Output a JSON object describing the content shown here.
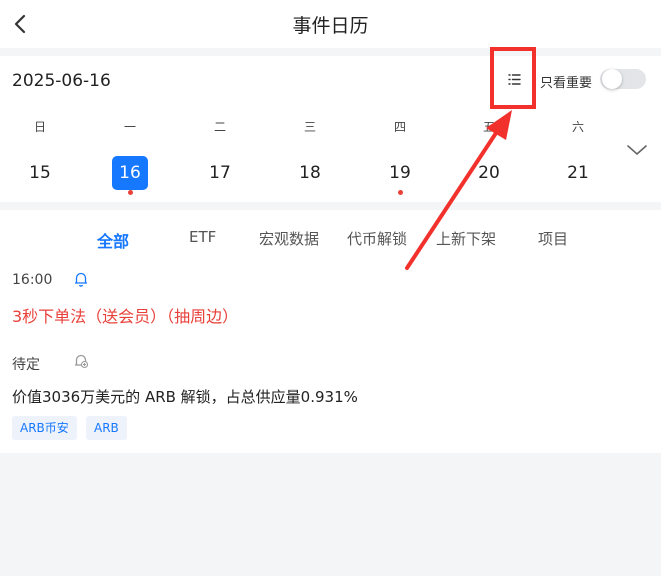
{
  "header": {
    "title": "事件日历",
    "back_icon": "chevron-left-icon"
  },
  "calendar": {
    "date": "2025-06-16",
    "list_icon": "list-icon",
    "important_only_label": "只看重要",
    "important_only_on": false,
    "weekdays": [
      "日",
      "一",
      "二",
      "三",
      "四",
      "五",
      "六"
    ],
    "days": [
      {
        "num": "15",
        "selected": false,
        "dot": false
      },
      {
        "num": "16",
        "selected": true,
        "dot": true
      },
      {
        "num": "17",
        "selected": false,
        "dot": false
      },
      {
        "num": "18",
        "selected": false,
        "dot": false
      },
      {
        "num": "19",
        "selected": false,
        "dot": true
      },
      {
        "num": "20",
        "selected": false,
        "dot": false
      },
      {
        "num": "21",
        "selected": false,
        "dot": false
      }
    ],
    "expand_icon": "chevron-down-icon",
    "dot_color": "#e8413a",
    "selected_color": "#1677ff"
  },
  "tabs": [
    "全部",
    "ETF",
    "宏观数据",
    "代币解锁",
    "上新下架",
    "项目"
  ],
  "events": [
    {
      "time": "16:00",
      "title": "3秒下单法（送会员）（抽周边）",
      "color": "#e8413a",
      "tags": []
    },
    {
      "time": "待定",
      "title": "价值3036万美元的 ARB 解锁，占总供应量0.931%",
      "color": "#222222",
      "tags": [
        "ARB币安",
        "ARB"
      ]
    }
  ],
  "annotation_color": "#f2312d"
}
